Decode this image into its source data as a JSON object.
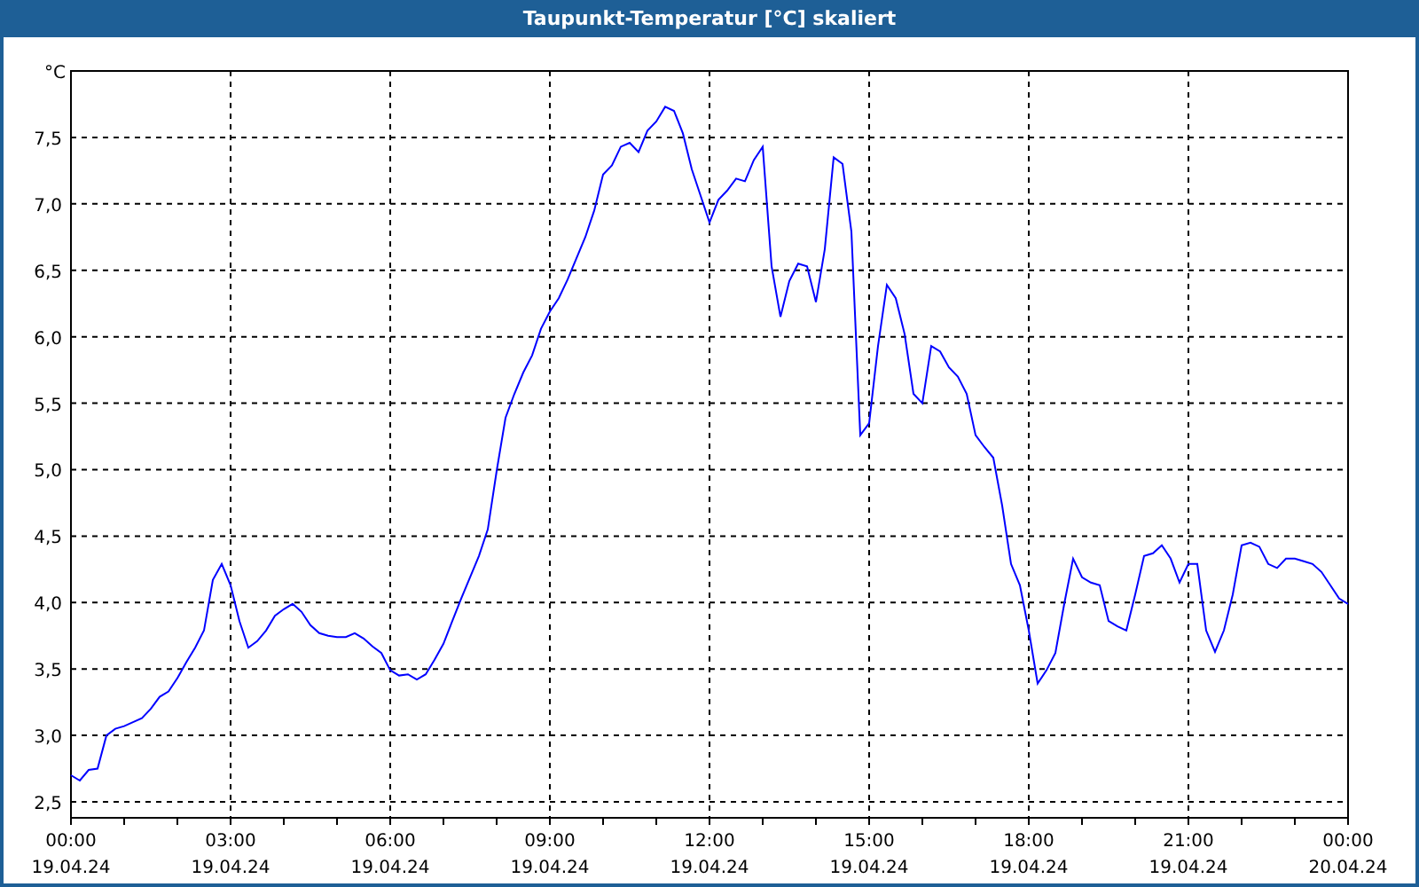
{
  "window": {
    "title": "Taupunkt-Temperatur [°C] skaliert"
  },
  "chart_data": {
    "type": "line",
    "grid": true,
    "ylabel": "°C",
    "ylim": [
      2.38,
      8.0
    ],
    "categories": [
      "00:00\n19.04.24",
      null,
      null,
      null,
      null,
      null,
      null,
      null,
      null,
      null,
      null,
      null,
      null,
      null,
      null,
      null,
      null,
      null,
      "03:00\n19.04.24",
      null,
      null,
      null,
      null,
      null,
      null,
      null,
      null,
      null,
      null,
      null,
      null,
      null,
      null,
      null,
      null,
      null,
      "06:00\n19.04.24",
      null,
      null,
      null,
      null,
      null,
      null,
      null,
      null,
      null,
      null,
      null,
      null,
      null,
      null,
      null,
      null,
      null,
      "09:00\n19.04.24",
      null,
      null,
      null,
      null,
      null,
      null,
      null,
      null,
      null,
      null,
      null,
      null,
      null,
      null,
      null,
      null,
      null,
      "12:00\n19.04.24",
      null,
      null,
      null,
      null,
      null,
      null,
      null,
      null,
      null,
      null,
      null,
      null,
      null,
      null,
      null,
      null,
      null,
      "15:00\n19.04.24",
      null,
      null,
      null,
      null,
      null,
      null,
      null,
      null,
      null,
      null,
      null,
      null,
      null,
      null,
      null,
      null,
      null,
      "18:00\n19.04.24",
      null,
      null,
      null,
      null,
      null,
      null,
      null,
      null,
      null,
      null,
      null,
      null,
      null,
      null,
      null,
      null,
      null,
      "21:00\n19.04.24",
      null,
      null,
      null,
      null,
      null,
      null,
      null,
      null,
      null,
      null,
      null,
      null,
      null,
      null,
      null,
      null,
      null,
      "00:00\n20.04.24"
    ],
    "yticks": [
      {
        "value": 2.5,
        "label": "2,5"
      },
      {
        "value": 3.0,
        "label": "3,0"
      },
      {
        "value": 3.5,
        "label": "3,5"
      },
      {
        "value": 4.0,
        "label": "4,0"
      },
      {
        "value": 4.5,
        "label": "4,5"
      },
      {
        "value": 5.0,
        "label": "5,0"
      },
      {
        "value": 5.5,
        "label": "5,5"
      },
      {
        "value": 6.0,
        "label": "6,0"
      },
      {
        "value": 6.5,
        "label": "6,5"
      },
      {
        "value": 7.0,
        "label": "7,0"
      },
      {
        "value": 7.5,
        "label": "7,5"
      }
    ],
    "series": [
      {
        "color": "#0000ff",
        "values": [
          2.7,
          2.66,
          2.74,
          2.75,
          3.0,
          3.05,
          3.07,
          3.1,
          3.13,
          3.2,
          3.29,
          3.33,
          3.43,
          3.55,
          3.66,
          3.79,
          4.17,
          4.29,
          4.13,
          3.86,
          3.66,
          3.71,
          3.79,
          3.9,
          3.95,
          3.99,
          3.93,
          3.83,
          3.77,
          3.75,
          3.74,
          3.74,
          3.77,
          3.73,
          3.67,
          3.62,
          3.49,
          3.45,
          3.46,
          3.42,
          3.46,
          3.57,
          3.69,
          3.86,
          4.03,
          4.19,
          4.35,
          4.55,
          4.99,
          5.39,
          5.57,
          5.73,
          5.86,
          6.06,
          6.19,
          6.29,
          6.43,
          6.59,
          6.75,
          6.95,
          7.22,
          7.29,
          7.43,
          7.46,
          7.39,
          7.55,
          7.62,
          7.73,
          7.7,
          7.53,
          7.26,
          7.06,
          6.86,
          7.03,
          7.1,
          7.19,
          7.17,
          7.33,
          7.43,
          6.53,
          6.15,
          6.42,
          6.55,
          6.53,
          6.26,
          6.66,
          7.35,
          7.3,
          6.79,
          5.26,
          5.35,
          5.93,
          6.39,
          6.29,
          6.02,
          5.57,
          5.5,
          5.93,
          5.89,
          5.77,
          5.7,
          5.57,
          5.26,
          5.17,
          5.09,
          4.73,
          4.29,
          4.13,
          3.79,
          3.39,
          3.49,
          3.62,
          3.99,
          4.33,
          4.19,
          4.15,
          4.13,
          3.86,
          3.82,
          3.79,
          4.06,
          4.35,
          4.37,
          4.43,
          4.33,
          4.15,
          4.29,
          4.29,
          3.79,
          3.63,
          3.79,
          4.06,
          4.43,
          4.45,
          4.42,
          4.29,
          4.26,
          4.33,
          4.33,
          4.31,
          4.29,
          4.23,
          4.13,
          4.03,
          3.99
        ]
      }
    ]
  }
}
